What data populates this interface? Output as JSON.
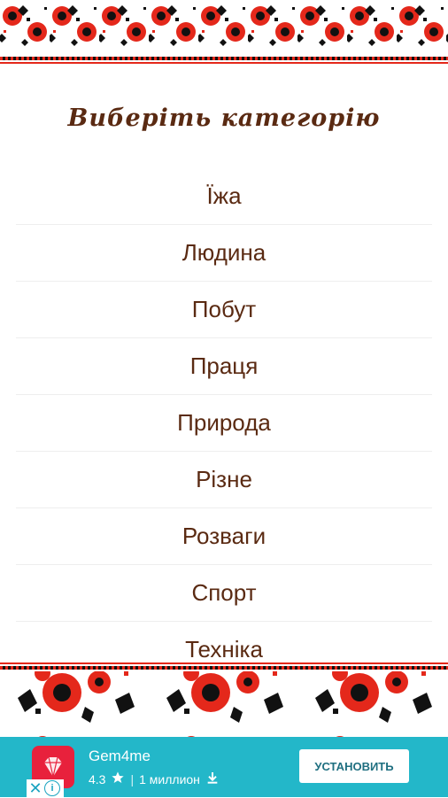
{
  "header": {
    "title": "Виберіть категорію"
  },
  "categories": [
    {
      "label": "Їжа"
    },
    {
      "label": "Людина"
    },
    {
      "label": "Побут"
    },
    {
      "label": "Праця"
    },
    {
      "label": "Природа"
    },
    {
      "label": "Різне"
    },
    {
      "label": "Розваги"
    },
    {
      "label": "Спорт"
    },
    {
      "label": "Техніка"
    }
  ],
  "ad": {
    "app_name": "Gem4me",
    "rating": "4.3",
    "installs": "1 миллион",
    "install_button": "УСТАНОВИТЬ",
    "icons": [
      "star-icon",
      "download-icon",
      "close-icon",
      "info-icon",
      "gem-icon"
    ]
  },
  "colors": {
    "text": "#5a2a12",
    "red": "#e4281b",
    "black": "#111111",
    "ad_bg": "#23b7c9"
  }
}
